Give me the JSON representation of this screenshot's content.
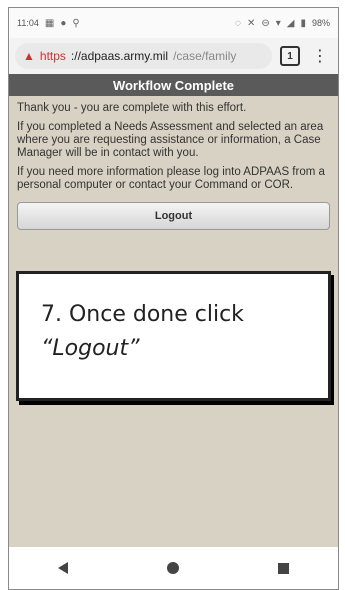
{
  "status_bar": {
    "time": "11:04",
    "battery": "98%"
  },
  "browser": {
    "url_scheme": "https",
    "url_host": "://adpaas.army.mil",
    "url_path": "/case/family",
    "tab_count": "1"
  },
  "page": {
    "header_title": "Workflow Complete",
    "paragraphs": [
      "Thank you - you are complete with this effort.",
      "If you completed a Needs Assessment and selected an area where you are requesting assistance or information, a Case Manager will be in contact with you.",
      "If you need more information please log into ADPAAS from a personal computer or contact your Command or COR."
    ],
    "logout_label": "Logout"
  },
  "callout": {
    "line1": "7. Once done click",
    "line2": "“Logout”"
  },
  "colors": {
    "header_bg": "#5a5a5a",
    "content_bg": "#d8d2c4",
    "warning_red": "#d32f2f"
  }
}
